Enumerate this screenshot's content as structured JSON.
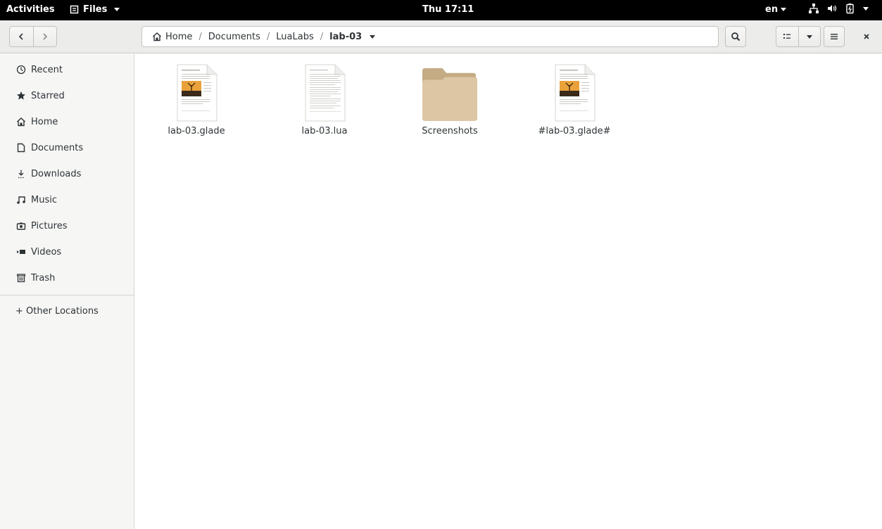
{
  "topbar": {
    "activities": "Activities",
    "app_menu": "Files",
    "clock": "Thu 17:11",
    "language": "en"
  },
  "headerbar": {
    "breadcrumbs": [
      "Home",
      "Documents",
      "LuaLabs",
      "lab-03"
    ]
  },
  "sidebar": {
    "items": [
      {
        "label": "Recent",
        "icon": "clock-icon"
      },
      {
        "label": "Starred",
        "icon": "star-icon"
      },
      {
        "label": "Home",
        "icon": "home-icon"
      },
      {
        "label": "Documents",
        "icon": "document-icon"
      },
      {
        "label": "Downloads",
        "icon": "download-icon"
      },
      {
        "label": "Music",
        "icon": "music-icon"
      },
      {
        "label": "Pictures",
        "icon": "camera-icon"
      },
      {
        "label": "Videos",
        "icon": "video-icon"
      },
      {
        "label": "Trash",
        "icon": "trash-icon"
      }
    ],
    "other_locations": "+ Other Locations"
  },
  "files": [
    {
      "name": "lab-03.glade",
      "type": "document-with-image"
    },
    {
      "name": "lab-03.lua",
      "type": "text-document"
    },
    {
      "name": "Screenshots",
      "type": "folder"
    },
    {
      "name": "#lab-03.glade#",
      "type": "document-with-image"
    }
  ],
  "colors": {
    "topbar_bg": "#000000",
    "headerbar_bg": "#ececea",
    "sidebar_bg": "#f6f6f5",
    "folder": "#dcc6a3",
    "folder_tab": "#c4ab84"
  }
}
